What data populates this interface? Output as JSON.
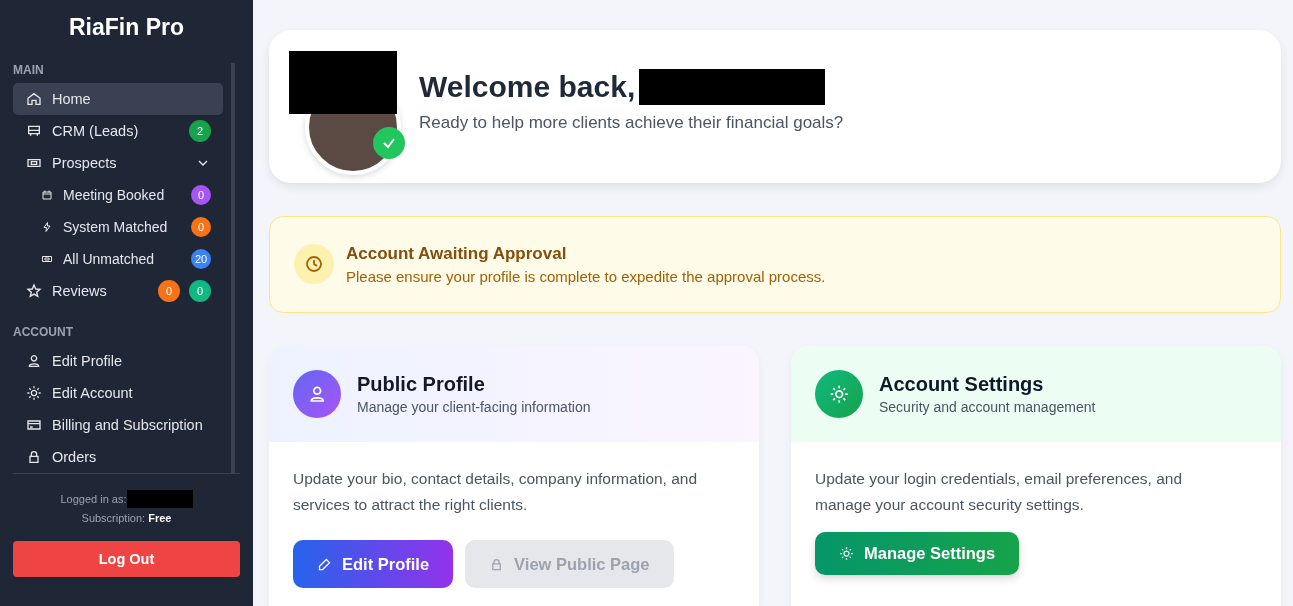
{
  "sidebar": {
    "brand": "RiaFin Pro",
    "sections": [
      {
        "heading": "MAIN",
        "items": [
          {
            "kind": "item",
            "label": "Home",
            "selected": true
          },
          {
            "kind": "item",
            "label": "CRM (Leads)",
            "selected": false,
            "badges": [
              {
                "text": "2",
                "color": "#16a34a"
              }
            ]
          },
          {
            "kind": "group",
            "label": "Prospects",
            "selected": false,
            "expanded": true,
            "children": [
              {
                "label": "Meeting Booked",
                "selected": false,
                "badges": [
                  {
                    "text": "0",
                    "color": "#a855f7"
                  }
                ]
              },
              {
                "label": "System Matched",
                "selected": false,
                "badges": [
                  {
                    "text": "0",
                    "color": "#f97316"
                  }
                ]
              },
              {
                "label": "All Unmatched",
                "selected": false,
                "badges": [
                  {
                    "text": "20",
                    "color": "#3b82f6"
                  }
                ]
              }
            ]
          },
          {
            "kind": "item",
            "label": "Reviews",
            "selected": false,
            "badges": [
              {
                "text": "0",
                "color": "#f97316"
              },
              {
                "text": "0",
                "color": "#10b981"
              }
            ]
          }
        ]
      },
      {
        "heading": "ACCOUNT",
        "items": [
          {
            "kind": "item",
            "label": "Edit Profile",
            "selected": false
          },
          {
            "kind": "item",
            "label": "Edit Account",
            "selected": false
          },
          {
            "kind": "item",
            "label": "Billing and Subscription",
            "selected": false
          },
          {
            "kind": "item",
            "label": "Orders",
            "selected": false
          }
        ]
      }
    ],
    "logged_in_label": "Logged in as:",
    "subscription_label": "Subscription:",
    "subscription_value": "Free",
    "logout": "Log Out"
  },
  "welcome": {
    "title": "Welcome back,",
    "subtitle": "Ready to help more clients achieve their financial goals?",
    "verified": true
  },
  "alert": {
    "title": "Account Awaiting Approval",
    "message": "Please ensure your profile is complete to expedite the approval process."
  },
  "cards": [
    {
      "kind": "profile",
      "title": "Public Profile",
      "subtitle": "Manage your client-facing information",
      "body": "Update your bio, contact details, company information, and services to attract the right clients.",
      "buttons": [
        {
          "label": "Edit Profile",
          "disabled": false
        },
        {
          "label": "View Public Page",
          "disabled": true
        }
      ]
    },
    {
      "kind": "settings",
      "title": "Account Settings",
      "subtitle": "Security and account management",
      "body": "Update your login credentials, email preferences, and manage your account security settings.",
      "buttons": [
        {
          "label": "Manage Settings",
          "disabled": false
        }
      ]
    }
  ]
}
